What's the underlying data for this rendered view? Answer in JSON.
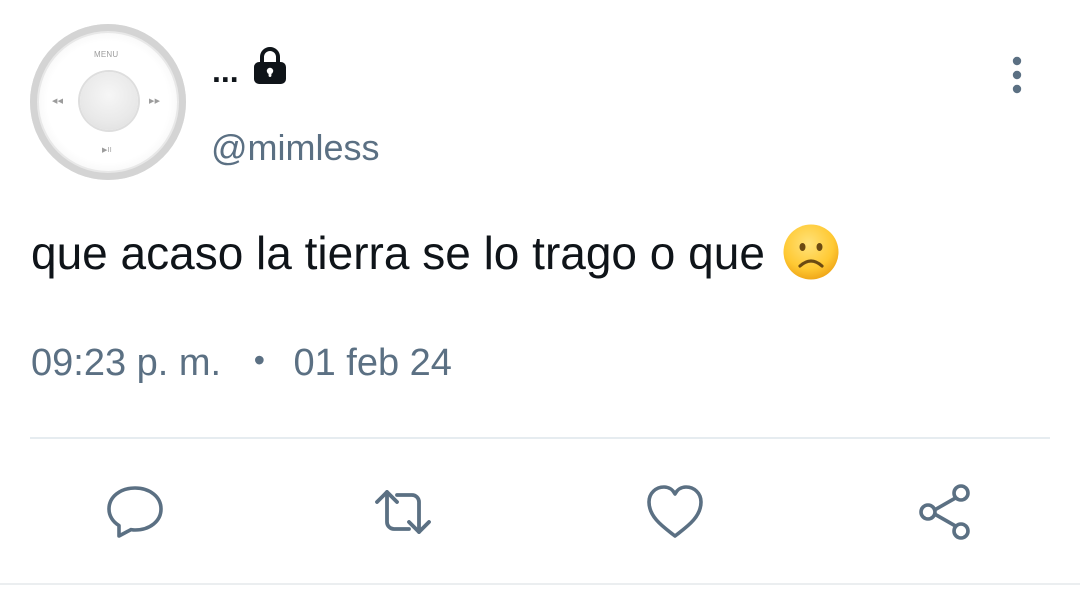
{
  "header": {
    "display_name": "...",
    "handle": "@mimless"
  },
  "avatar": {
    "menu_label": "MENU",
    "prev_glyph": "◀◀",
    "next_glyph": "▶▶",
    "play_glyph": "▶II"
  },
  "tweet": {
    "text": "que acaso la tierra se lo trago o que",
    "emoji": "frowning-face-emoji"
  },
  "meta": {
    "time": "09:23 p. m.",
    "separator": "•",
    "date": "01 feb 24"
  },
  "actions": [
    {
      "name": "reply",
      "icon": "speech-bubble-icon"
    },
    {
      "name": "retweet",
      "icon": "retweet-icon"
    },
    {
      "name": "like",
      "icon": "heart-icon"
    },
    {
      "name": "share",
      "icon": "share-icon"
    }
  ],
  "colors": {
    "text": "#0f1419",
    "secondary": "#5b7083",
    "divider": "#e6ecf0"
  }
}
